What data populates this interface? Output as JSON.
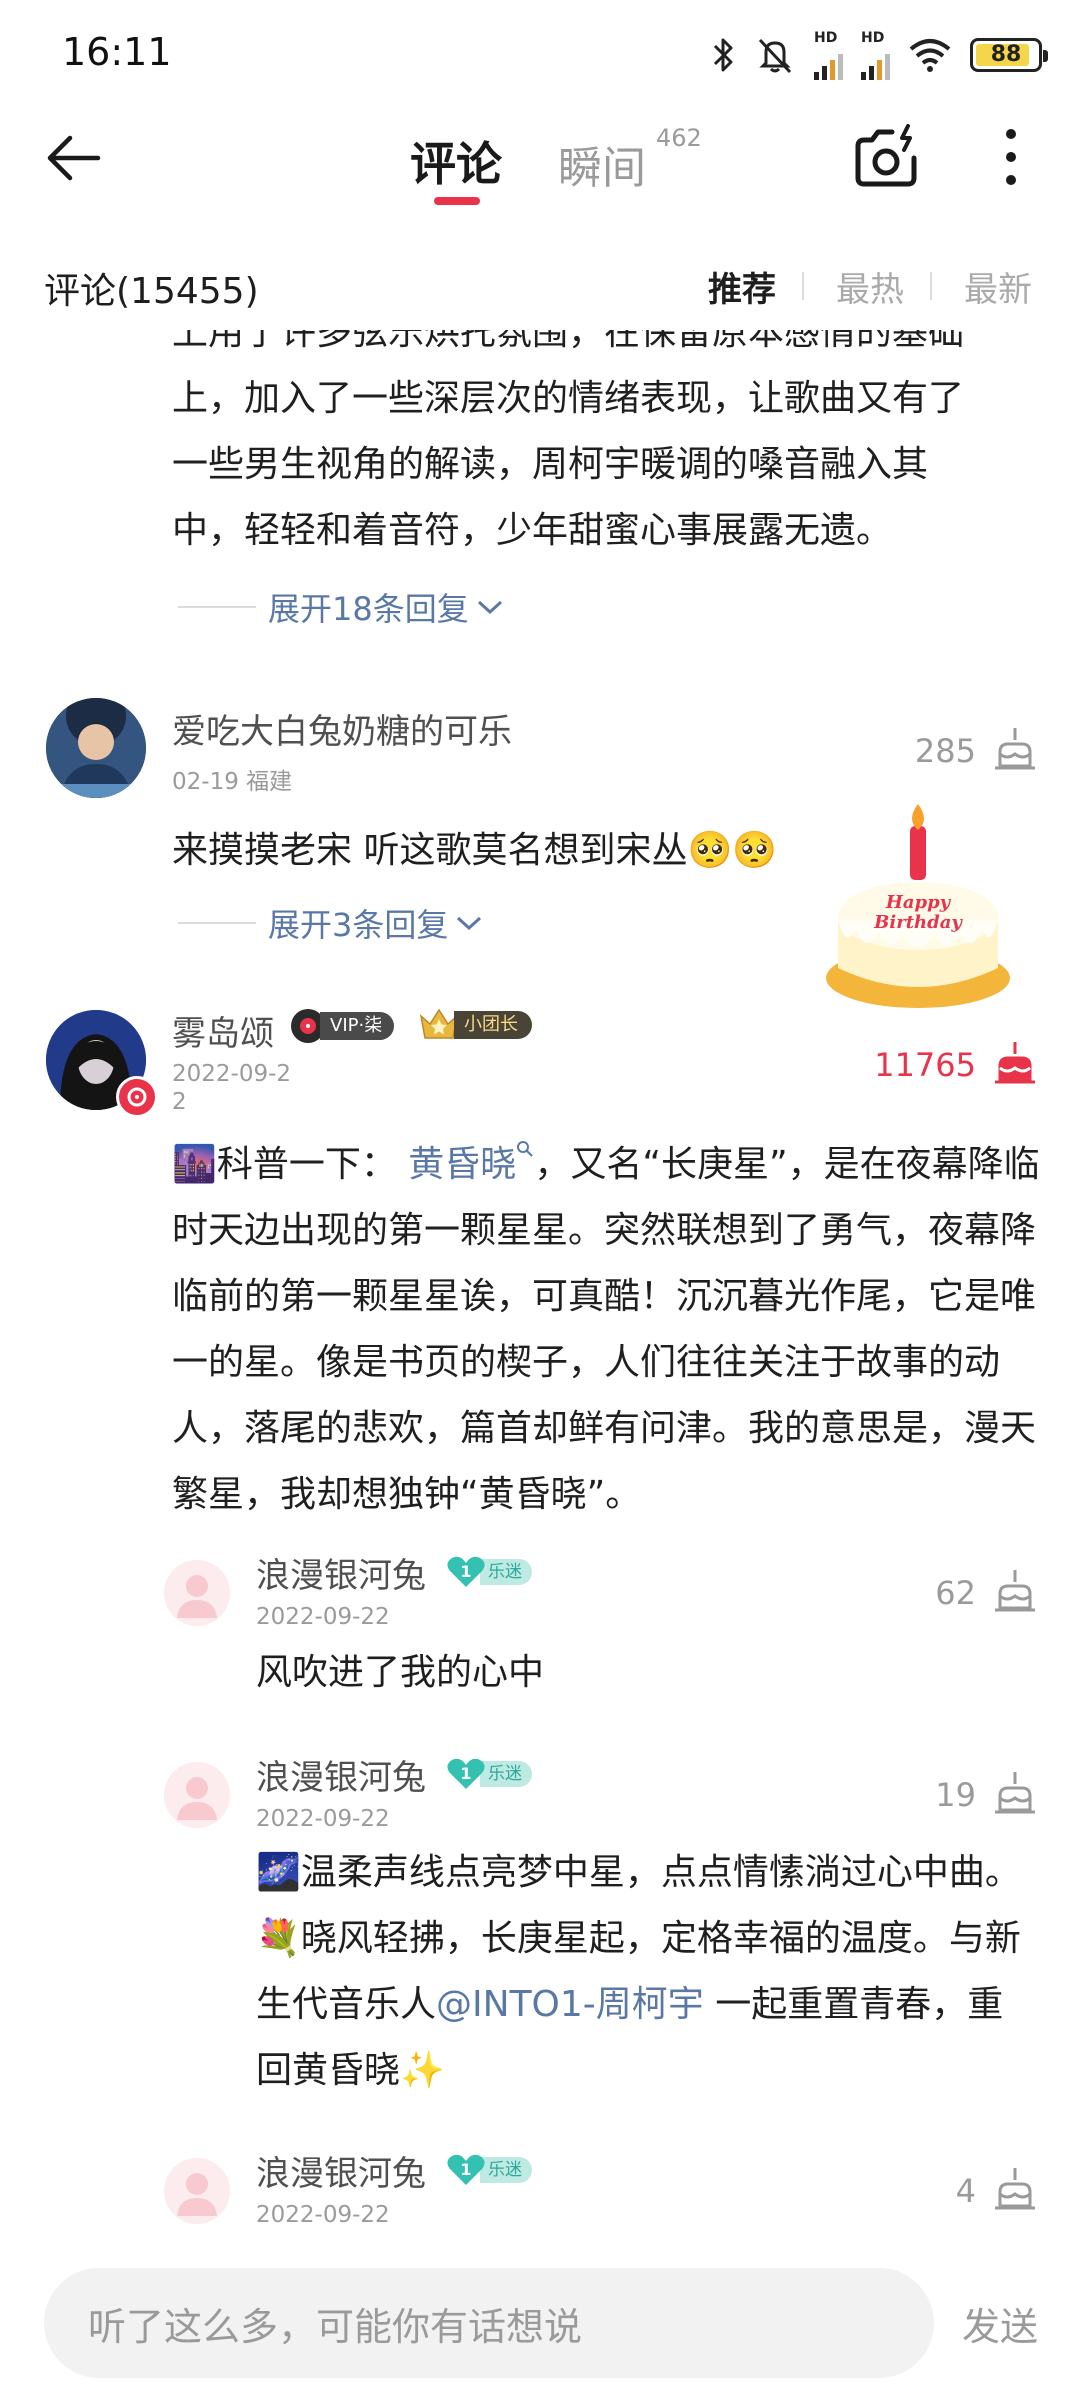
{
  "status_bar": {
    "time": "16:11",
    "battery": "88",
    "network_label": "HD",
    "icons": [
      "bluetooth-icon",
      "mute-vibrate-icon",
      "signal-hd-icon",
      "signal-hd-icon",
      "wifi-icon",
      "battery-icon"
    ]
  },
  "header": {
    "tabs": [
      {
        "label": "评论",
        "active": true
      },
      {
        "label": "瞬间",
        "count": "462",
        "active": false
      }
    ],
    "icons": [
      "back-arrow-icon",
      "camera-icon",
      "more-vertical-icon"
    ]
  },
  "sort_bar": {
    "count_label": "评论(15455)",
    "options": [
      "推荐",
      "最热",
      "最新"
    ],
    "selected": "推荐"
  },
  "partial_comment": {
    "lines": [
      "上用了许多弦乐烘托氛围，在保留原本感情的基础",
      "上，加入了一些深层次的情绪表现，让歌曲又有了",
      "一些男生视角的解读，周柯宇暖调的嗓音融入其",
      "中，轻轻和着音符，少年甜蜜心事展露无遗。"
    ],
    "expand_label": "展开18条回复"
  },
  "comments": [
    {
      "username": "爱吃大白兔奶糖的可乐",
      "date": "02-19",
      "location": "福建",
      "likes": "285",
      "text": "来摸摸老宋 听这歌莫名想到宋丛🥺🥺",
      "expand_label": "展开3条回复",
      "sticker_line1": "Happy",
      "sticker_line2": "Birthday"
    },
    {
      "username": "雾岛颂",
      "vip_badge": "VIP·柒",
      "group_badge": "小团长",
      "date_line1": "2022-09-2",
      "date_line2": "2",
      "likes": "11765",
      "text_parts": {
        "emoji": "🌆",
        "prefix": "科普一下：",
        "link": "黄昏晓",
        "rest": "，又名“长庚星”，是在夜幕降临时天边出现的第一颗星星。突然联想到了勇气，夜幕降临前的第一颗星星诶，可真酷！沉沉暮光作尾，它是唯一的星。像是书页的楔子，人们往往关注于故事的动人，落尾的悲欢，篇首却鲜有问津。我的意思是，漫天繁星，我却想独钟“黄昏晓”。"
      }
    }
  ],
  "replies": [
    {
      "username": "浪漫银河兔",
      "level": "1",
      "level_tag": "乐迷",
      "date": "2022-09-22",
      "likes": "62",
      "text": "风吹进了我的心中"
    },
    {
      "username": "浪漫银河兔",
      "level": "1",
      "level_tag": "乐迷",
      "date": "2022-09-22",
      "likes": "19",
      "text_parts": {
        "emoji1": "🌌",
        "part1": "温柔声线点亮梦中星，点点情愫淌过心中曲。",
        "emoji2": "💐",
        "part2": "晓风轻拂，长庚星起，定格幸福的温度。与新生代音乐人",
        "mention": "@INTO1-周柯宇",
        "part3": " 一起重置青春，重回黄昏晓",
        "emoji3": "✨"
      }
    },
    {
      "username": "浪漫银河兔",
      "level": "1",
      "level_tag": "乐迷",
      "date": "2022-09-22",
      "likes": "4"
    }
  ],
  "input_bar": {
    "placeholder": "听了这么多，可能你有话想说",
    "send_label": "发送"
  },
  "colors": {
    "accent_red": "#e8334a",
    "link_blue": "#5a78a6",
    "muted_gray": "#9a9a9a",
    "level_teal": "#2aa99a"
  }
}
